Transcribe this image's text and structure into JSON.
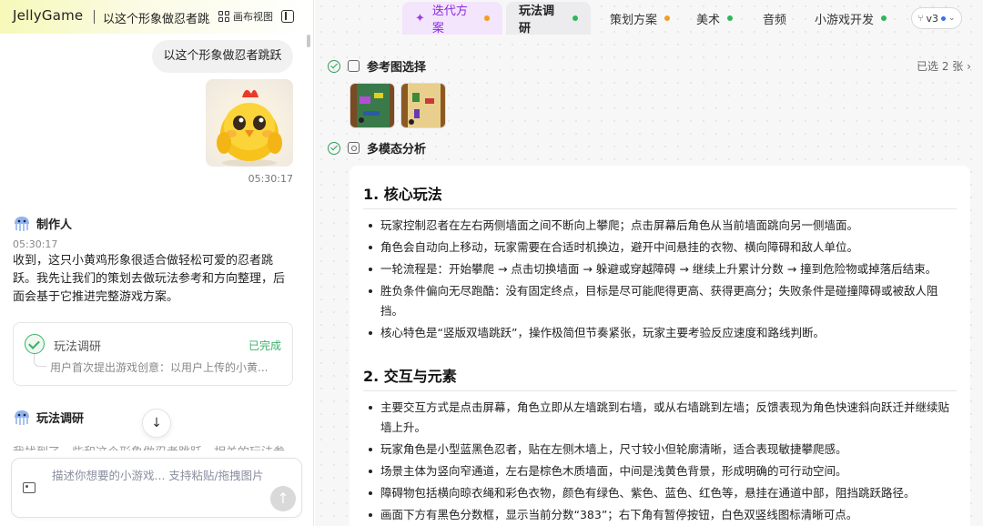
{
  "app": {
    "brand": "JellyGame",
    "project_title": "以这个形象做忍者跳跃",
    "canvas_view_label": "画布视图"
  },
  "chat": {
    "user_message": "以这个形象做忍者跳跃",
    "user_time": "05:30:17",
    "agent_name": "制作人",
    "agent_time": "05:30:17",
    "agent_message": "收到，这只小黄鸡形象很适合做轻松可爱的忍者跳跃。我先让我们的策划去做玩法参考和方向整理，后面会基于它推进完整游戏方案。",
    "task_card": {
      "title": "玩法调研",
      "status": "已完成",
      "description": "用户首次提出游戏创意：以用户上传的小黄..."
    },
    "agent2_name": "玩法调研",
    "agent2_message": "我找到了一些和这个形象做忍者跳跃，相关的玩法参考",
    "input_placeholder": "描述你想要的小游戏... 支持粘贴/拖拽图片"
  },
  "tabs": [
    {
      "label": "迭代方案",
      "dot_color": "#f0a020"
    },
    {
      "label": "玩法调研",
      "dot_color": "#2fb65a"
    },
    {
      "label": "策划方案",
      "dot_color": "#f0a020"
    },
    {
      "label": "美术",
      "dot_color": "#2fb65a"
    },
    {
      "label": "音频",
      "dot_color": ""
    },
    {
      "label": "小游戏开发",
      "dot_color": "#2fb65a"
    }
  ],
  "version": "v3",
  "sections": {
    "reference": {
      "title": "参考图选择",
      "selected": "已选 2 张"
    },
    "analysis": {
      "title": "多模态分析"
    }
  },
  "doc": {
    "h1": "1. 核心玩法",
    "core": [
      "玩家控制忍者在左右两侧墙面之间不断向上攀爬；点击屏幕后角色从当前墙面跳向另一侧墙面。",
      "角色会自动向上移动，玩家需要在合适时机换边，避开中间悬挂的衣物、横向障碍和敌人单位。",
      "一轮流程是：开始攀爬 → 点击切换墙面 → 躲避或穿越障碍 → 继续上升累计分数 → 撞到危险物或掉落后结束。",
      "胜负条件偏向无尽跑酷：没有固定终点，目标是尽可能爬得更高、获得更高分；失败条件是碰撞障碍或被敌人阻挡。",
      "核心特色是“竖版双墙跳跃”，操作极简但节奏紧张，玩家主要考验反应速度和路线判断。"
    ],
    "h2": "2. 交互与元素",
    "interaction": [
      "主要交互方式是点击屏幕，角色立即从左墙跳到右墙，或从右墙跳到左墙；反馈表现为角色快速斜向跃迁并继续贴墙上升。",
      "玩家角色是小型蓝黑色忍者，贴在左侧木墙上，尺寸较小但轮廓清晰，适合表现敏捷攀爬感。",
      "场景主体为竖向窄通道，左右是棕色木质墙面，中间是浅黄色背景，形成明确的可行动空间。",
      "障碍物包括横向晾衣绳和彩色衣物，颜色有绿色、紫色、蓝色、红色等，悬挂在通道中部，阻挡跳跃路径。",
      "画面下方有黑色分数框，显示当前分数“383”；右下角有暂停按钮，白色双竖线图标清晰可点。"
    ]
  }
}
